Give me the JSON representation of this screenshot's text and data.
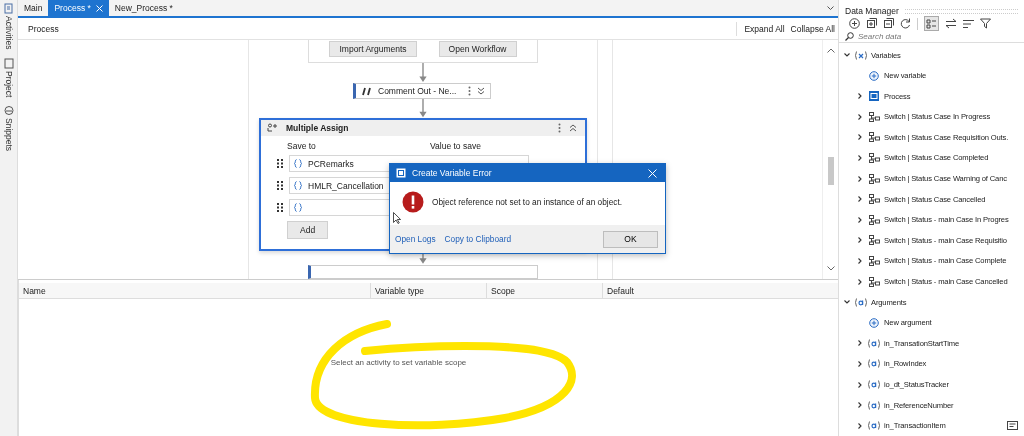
{
  "side_tabs": [
    {
      "label": "Activities",
      "kind": "activities"
    },
    {
      "label": "Project",
      "kind": "project"
    },
    {
      "label": "Snippets",
      "kind": "snippets"
    }
  ],
  "tabs": [
    {
      "label": "Main",
      "selected": false
    },
    {
      "label": "Process *",
      "selected": true
    },
    {
      "label": "New_Process *",
      "selected": false
    }
  ],
  "breadcrumb": "Process",
  "toolbar_links": [
    "Expand All",
    "Collapse All"
  ],
  "workflow": {
    "buttons": [
      "Import Arguments",
      "Open Workflow"
    ],
    "comment": {
      "title": "Comment Out - Ne..."
    },
    "assign": {
      "title": "Multiple Assign",
      "columns": [
        "Save to",
        "Value to save"
      ],
      "rows": [
        {
          "save_to": "PCRemarks"
        },
        {
          "save_to": "HMLR_Cancellation"
        },
        {}
      ],
      "add_button": "Add"
    }
  },
  "dialog": {
    "title": "Create Variable Error",
    "message": "Object reference not set to an instance of an object.",
    "links": [
      "Open Logs",
      "Copy to Clipboard"
    ],
    "button": "OK"
  },
  "variables_panel": {
    "columns": [
      "Name",
      "Variable type",
      "Scope",
      "Default"
    ],
    "empty_message": "Select an activity to set variable scope"
  },
  "data_manager": {
    "title": "Data Manager",
    "search": {
      "placeholder": "Search data"
    },
    "tree": [
      {
        "label": "Variables",
        "kind": "variables",
        "expanded": true,
        "children": [
          {
            "label": "New variable",
            "kind": "new"
          },
          {
            "label": "Process",
            "kind": "process",
            "expanded": false
          },
          {
            "label": "Switch | Status Case In Progress",
            "kind": "switch",
            "expanded": false
          },
          {
            "label": "Switch | Status Case Requisition Outs.",
            "kind": "switch",
            "expanded": false
          },
          {
            "label": "Switch | Status Case Completed",
            "kind": "switch",
            "expanded": false
          },
          {
            "label": "Switch | Status Case Warning of Canc",
            "kind": "switch",
            "expanded": false
          },
          {
            "label": "Switch | Status Case Cancelled",
            "kind": "switch",
            "expanded": false
          },
          {
            "label": "Switch | Status - main Case In Progres",
            "kind": "switch",
            "expanded": false
          },
          {
            "label": "Switch | Status - main Case Requisitio",
            "kind": "switch",
            "expanded": false
          },
          {
            "label": "Switch | Status - main Case Complete",
            "kind": "switch",
            "expanded": false
          },
          {
            "label": "Switch | Status - main Case Cancelled",
            "kind": "switch",
            "expanded": false
          }
        ]
      },
      {
        "label": "Arguments",
        "kind": "arguments",
        "expanded": true,
        "children": [
          {
            "label": "New argument",
            "kind": "new"
          },
          {
            "label": "in_TransationStartTime",
            "kind": "argument",
            "expanded": false
          },
          {
            "label": "in_RowIndex",
            "kind": "argument",
            "expanded": false
          },
          {
            "label": "io_dt_StatusTracker",
            "kind": "argument",
            "expanded": false
          },
          {
            "label": "in_ReferenceNumber",
            "kind": "argument",
            "expanded": false
          },
          {
            "label": "in_TransactionItem",
            "kind": "argument",
            "expanded": false,
            "annotated": true
          }
        ]
      }
    ]
  }
}
